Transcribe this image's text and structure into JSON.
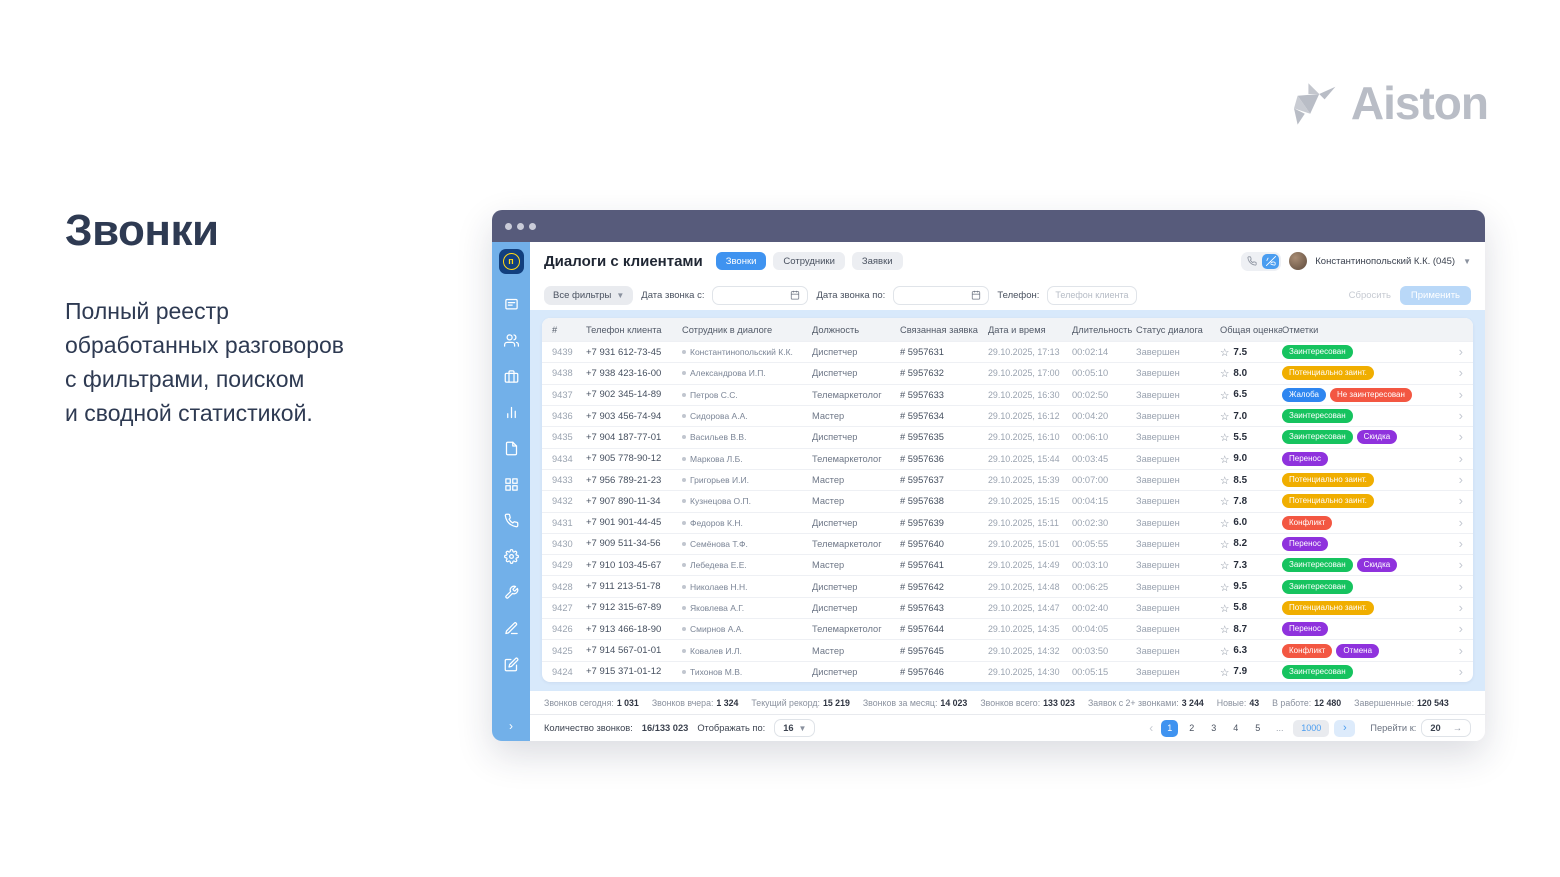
{
  "page": {
    "title": "Звонки",
    "description": "Полный реестр\nобработанных разговоров\nс фильтрами, поиском\nи сводной статистикой.",
    "brand": "Aiston"
  },
  "colors": {
    "accent": "#3f93f0",
    "titlebar": "#575b7b",
    "sidebar": "#72b0e9",
    "panel": "#d8e9fb",
    "tag_green": "#16c35f",
    "tag_yellow": "#f0ae00",
    "tag_blue": "#2e86f0",
    "tag_red": "#f35742",
    "tag_purple": "#8f32dd",
    "brand_grey": "#b9bdc6"
  },
  "window": {
    "header": {
      "title": "Диалоги с клиентами",
      "tabs": [
        {
          "label": "Звонки",
          "active": true
        },
        {
          "label": "Сотрудники",
          "active": false
        },
        {
          "label": "Заявки",
          "active": false
        }
      ],
      "user": "Константинопольский К.К. (045)"
    },
    "sidebar_icons": [
      "chat",
      "users",
      "briefcase",
      "bar-chart",
      "document",
      "grid",
      "phone",
      "gear",
      "tool",
      "pen",
      "edit"
    ],
    "filters": {
      "all_filters": "Все фильтры",
      "date_from_label": "Дата звонка с:",
      "date_to_label": "Дата звонка по:",
      "phone_label": "Телефон:",
      "phone_placeholder": "Телефон клиента",
      "reset": "Сбросить",
      "apply": "Применить"
    },
    "table": {
      "columns": [
        "#",
        "Телефон клиента",
        "Сотрудник в диалоге",
        "Должность",
        "Связанная заявка",
        "Дата и время",
        "Длительность",
        "Статус диалога",
        "Общая оценка",
        "Отметки",
        ""
      ],
      "rows": [
        {
          "id": "9439",
          "phone": "+7 931 612-73-45",
          "employee": "Константинопольский К.К.",
          "role": "Диспетчер",
          "ticket": "# 5957631",
          "datetime": "29.10.2025, 17:13",
          "duration": "00:02:14",
          "status": "Завершен",
          "rating": "7.5",
          "tags": [
            {
              "label": "Заинтересован",
              "color": "green"
            }
          ]
        },
        {
          "id": "9438",
          "phone": "+7 938 423-16-00",
          "employee": "Александрова И.П.",
          "role": "Диспетчер",
          "ticket": "# 5957632",
          "datetime": "29.10.2025, 17:00",
          "duration": "00:05:10",
          "status": "Завершен",
          "rating": "8.0",
          "tags": [
            {
              "label": "Потенциально заинт.",
              "color": "yellow"
            }
          ]
        },
        {
          "id": "9437",
          "phone": "+7 902 345-14-89",
          "employee": "Петров С.С.",
          "role": "Телемаркетолог",
          "ticket": "# 5957633",
          "datetime": "29.10.2025, 16:30",
          "duration": "00:02:50",
          "status": "Завершен",
          "rating": "6.5",
          "tags": [
            {
              "label": "Жалоба",
              "color": "blue"
            },
            {
              "label": "Не заинтересован",
              "color": "red"
            }
          ]
        },
        {
          "id": "9436",
          "phone": "+7 903 456-74-94",
          "employee": "Сидорова А.А.",
          "role": "Мастер",
          "ticket": "# 5957634",
          "datetime": "29.10.2025, 16:12",
          "duration": "00:04:20",
          "status": "Завершен",
          "rating": "7.0",
          "tags": [
            {
              "label": "Заинтересован",
              "color": "green"
            }
          ]
        },
        {
          "id": "9435",
          "phone": "+7 904 187-77-01",
          "employee": "Васильев В.В.",
          "role": "Диспетчер",
          "ticket": "# 5957635",
          "datetime": "29.10.2025, 16:10",
          "duration": "00:06:10",
          "status": "Завершен",
          "rating": "5.5",
          "tags": [
            {
              "label": "Заинтересован",
              "color": "green"
            },
            {
              "label": "Скидка",
              "color": "purple"
            }
          ]
        },
        {
          "id": "9434",
          "phone": "+7 905 778-90-12",
          "employee": "Маркова Л.Б.",
          "role": "Телемаркетолог",
          "ticket": "# 5957636",
          "datetime": "29.10.2025, 15:44",
          "duration": "00:03:45",
          "status": "Завершен",
          "rating": "9.0",
          "tags": [
            {
              "label": "Перенос",
              "color": "purple"
            }
          ]
        },
        {
          "id": "9433",
          "phone": "+7 956 789-21-23",
          "employee": "Григорьев И.И.",
          "role": "Мастер",
          "ticket": "# 5957637",
          "datetime": "29.10.2025, 15:39",
          "duration": "00:07:00",
          "status": "Завершен",
          "rating": "8.5",
          "tags": [
            {
              "label": "Потенциально заинт.",
              "color": "yellow"
            }
          ]
        },
        {
          "id": "9432",
          "phone": "+7 907 890-11-34",
          "employee": "Кузнецова О.П.",
          "role": "Мастер",
          "ticket": "# 5957638",
          "datetime": "29.10.2025, 15:15",
          "duration": "00:04:15",
          "status": "Завершен",
          "rating": "7.8",
          "tags": [
            {
              "label": "Потенциально заинт.",
              "color": "yellow"
            }
          ]
        },
        {
          "id": "9431",
          "phone": "+7 901 901-44-45",
          "employee": "Федоров К.Н.",
          "role": "Диспетчер",
          "ticket": "# 5957639",
          "datetime": "29.10.2025, 15:11",
          "duration": "00:02:30",
          "status": "Завершен",
          "rating": "6.0",
          "tags": [
            {
              "label": "Конфликт",
              "color": "red"
            }
          ]
        },
        {
          "id": "9430",
          "phone": "+7 909 511-34-56",
          "employee": "Семёнова Т.Ф.",
          "role": "Телемаркетолог",
          "ticket": "# 5957640",
          "datetime": "29.10.2025, 15:01",
          "duration": "00:05:55",
          "status": "Завершен",
          "rating": "8.2",
          "tags": [
            {
              "label": "Перенос",
              "color": "purple"
            }
          ]
        },
        {
          "id": "9429",
          "phone": "+7 910 103-45-67",
          "employee": "Лебедева Е.Е.",
          "role": "Мастер",
          "ticket": "# 5957641",
          "datetime": "29.10.2025, 14:49",
          "duration": "00:03:10",
          "status": "Завершен",
          "rating": "7.3",
          "tags": [
            {
              "label": "Заинтересован",
              "color": "green"
            },
            {
              "label": "Скидка",
              "color": "purple"
            }
          ]
        },
        {
          "id": "9428",
          "phone": "+7 911 213-51-78",
          "employee": "Николаев Н.Н.",
          "role": "Диспетчер",
          "ticket": "# 5957642",
          "datetime": "29.10.2025, 14:48",
          "duration": "00:06:25",
          "status": "Завершен",
          "rating": "9.5",
          "tags": [
            {
              "label": "Заинтересован",
              "color": "green"
            }
          ]
        },
        {
          "id": "9427",
          "phone": "+7 912 315-67-89",
          "employee": "Яковлева А.Г.",
          "role": "Диспетчер",
          "ticket": "# 5957643",
          "datetime": "29.10.2025, 14:47",
          "duration": "00:02:40",
          "status": "Завершен",
          "rating": "5.8",
          "tags": [
            {
              "label": "Потенциально заинт.",
              "color": "yellow"
            }
          ]
        },
        {
          "id": "9426",
          "phone": "+7 913 466-18-90",
          "employee": "Смирнов А.А.",
          "role": "Телемаркетолог",
          "ticket": "# 5957644",
          "datetime": "29.10.2025, 14:35",
          "duration": "00:04:05",
          "status": "Завершен",
          "rating": "8.7",
          "tags": [
            {
              "label": "Перенос",
              "color": "purple"
            }
          ]
        },
        {
          "id": "9425",
          "phone": "+7 914 567-01-01",
          "employee": "Ковалев И.Л.",
          "role": "Мастер",
          "ticket": "# 5957645",
          "datetime": "29.10.2025, 14:32",
          "duration": "00:03:50",
          "status": "Завершен",
          "rating": "6.3",
          "tags": [
            {
              "label": "Конфликт",
              "color": "red"
            },
            {
              "label": "Отмена",
              "color": "purple"
            }
          ]
        },
        {
          "id": "9424",
          "phone": "+7 915 371-01-12",
          "employee": "Тихонов М.В.",
          "role": "Диспетчер",
          "ticket": "# 5957646",
          "datetime": "29.10.2025, 14:30",
          "duration": "00:05:15",
          "status": "Завершен",
          "rating": "7.9",
          "tags": [
            {
              "label": "Заинтересован",
              "color": "green"
            }
          ]
        }
      ]
    },
    "stats": [
      {
        "label": "Звонков сегодня:",
        "value": "1 031"
      },
      {
        "label": "Звонков вчера:",
        "value": "1 324"
      },
      {
        "label": "Текущий рекорд:",
        "value": "15 219"
      },
      {
        "label": "Звонков за месяц:",
        "value": "14 023"
      },
      {
        "label": "Звонков всего:",
        "value": "133 023"
      },
      {
        "label": "Заявок с 2+ звонками:",
        "value": "3 244"
      },
      {
        "label": "Новые:",
        "value": "43"
      },
      {
        "label": "В работе:",
        "value": "12 480"
      },
      {
        "label": "Завершенные:",
        "value": "120 543"
      }
    ],
    "footer": {
      "count_label": "Количество звонков:",
      "count_value": "16/133 023",
      "per_page_label": "Отображать по:",
      "per_page": "16",
      "pages": [
        {
          "label": "1",
          "style": "active"
        },
        {
          "label": "2",
          "style": ""
        },
        {
          "label": "3",
          "style": ""
        },
        {
          "label": "4",
          "style": ""
        },
        {
          "label": "5",
          "style": ""
        },
        {
          "label": "...",
          "style": "dots"
        },
        {
          "label": "1000",
          "style": "pill"
        }
      ],
      "goto_label": "Перейти к:",
      "goto_value": "20"
    }
  }
}
